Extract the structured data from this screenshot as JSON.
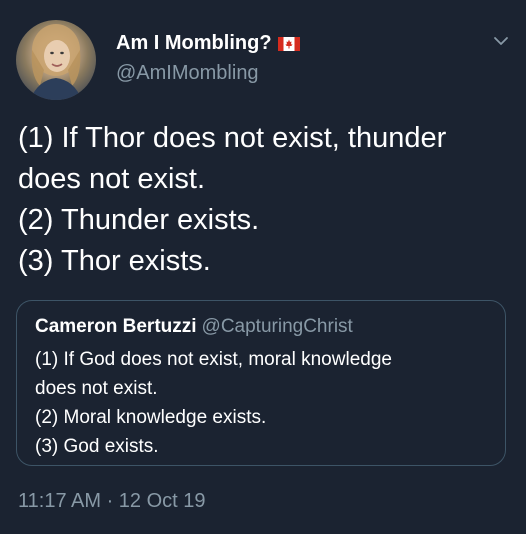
{
  "author": {
    "display_name": "Am I Mombling?",
    "handle": "@AmIMombling",
    "flag_icon": "canada-flag-icon"
  },
  "tweet": {
    "lines": [
      "(1) If Thor does not exist, thunder",
      "does not exist.",
      "(2) Thunder exists.",
      "(3) Thor exists."
    ],
    "timestamp": "11:17 AM · 12 Oct 19"
  },
  "quoted_tweet": {
    "display_name": "Cameron Bertuzzi",
    "handle": "@CapturingChrist",
    "lines": [
      "(1) If God does not exist, moral knowledge",
      "does not exist.",
      "(2) Moral knowledge exists.",
      "(3) God exists."
    ]
  },
  "colors": {
    "background": "#1b2331",
    "secondary_text": "#8899a6",
    "quote_border": "#3d5466"
  }
}
